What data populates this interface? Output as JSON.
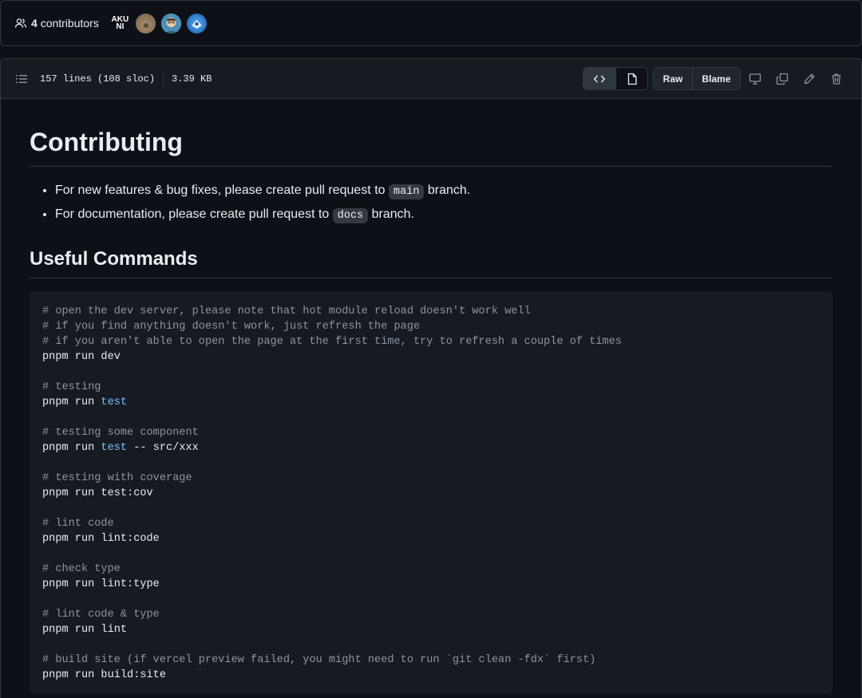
{
  "contributors": {
    "count": "4",
    "label": "contributors",
    "avatars": [
      {
        "name": "avatar-akuni",
        "text": "AKU NI"
      },
      {
        "name": "avatar-2",
        "text": ""
      },
      {
        "name": "avatar-3",
        "text": ""
      },
      {
        "name": "avatar-4",
        "text": ""
      }
    ]
  },
  "file_header": {
    "lines": "157 lines (108 sloc)",
    "size": "3.39 KB",
    "raw_label": "Raw",
    "blame_label": "Blame"
  },
  "readme": {
    "h1": "Contributing",
    "bullets": [
      {
        "before": "For new features & bug fixes, please create pull request to ",
        "code": "main",
        "after": " branch."
      },
      {
        "before": "For documentation, please create pull request to ",
        "code": "docs",
        "after": " branch."
      }
    ],
    "h2": "Useful Commands",
    "code_lines": [
      [
        {
          "t": "# open the dev server, please note that hot module reload doesn't work well",
          "c": "cmt"
        }
      ],
      [
        {
          "t": "# if you find anything doesn't work, just refresh the page",
          "c": "cmt"
        }
      ],
      [
        {
          "t": "# if you aren't able to open the page at the first time, try to refresh a couple of times",
          "c": "cmt"
        }
      ],
      [
        {
          "t": "pnpm run dev",
          "c": ""
        }
      ],
      [],
      [
        {
          "t": "# testing",
          "c": "cmt"
        }
      ],
      [
        {
          "t": "pnpm run ",
          "c": ""
        },
        {
          "t": "test",
          "c": "kw"
        }
      ],
      [],
      [
        {
          "t": "# testing some component",
          "c": "cmt"
        }
      ],
      [
        {
          "t": "pnpm run ",
          "c": ""
        },
        {
          "t": "test",
          "c": "kw"
        },
        {
          "t": " -- src/xxx",
          "c": ""
        }
      ],
      [],
      [
        {
          "t": "# testing with coverage",
          "c": "cmt"
        }
      ],
      [
        {
          "t": "pnpm run test:cov",
          "c": ""
        }
      ],
      [],
      [
        {
          "t": "# lint code",
          "c": "cmt"
        }
      ],
      [
        {
          "t": "pnpm run lint:code",
          "c": ""
        }
      ],
      [],
      [
        {
          "t": "# check type",
          "c": "cmt"
        }
      ],
      [
        {
          "t": "pnpm run lint:type",
          "c": ""
        }
      ],
      [],
      [
        {
          "t": "# lint code & type",
          "c": "cmt"
        }
      ],
      [
        {
          "t": "pnpm run lint",
          "c": ""
        }
      ],
      [],
      [
        {
          "t": "# build site (if vercel preview failed, you might need to run `git clean -fdx` first)",
          "c": "cmt"
        }
      ],
      [
        {
          "t": "pnpm run build:site",
          "c": ""
        }
      ]
    ]
  },
  "colors": {
    "background": "#0d1117",
    "header": "#161b22",
    "border": "#30363d",
    "comment": "#8b949e",
    "keyword": "#79c0ff"
  },
  "icons": [
    "people-icon",
    "list-icon",
    "code-view-icon",
    "file-preview-icon",
    "desktop-icon",
    "copy-icon",
    "pencil-icon",
    "trash-icon"
  ]
}
